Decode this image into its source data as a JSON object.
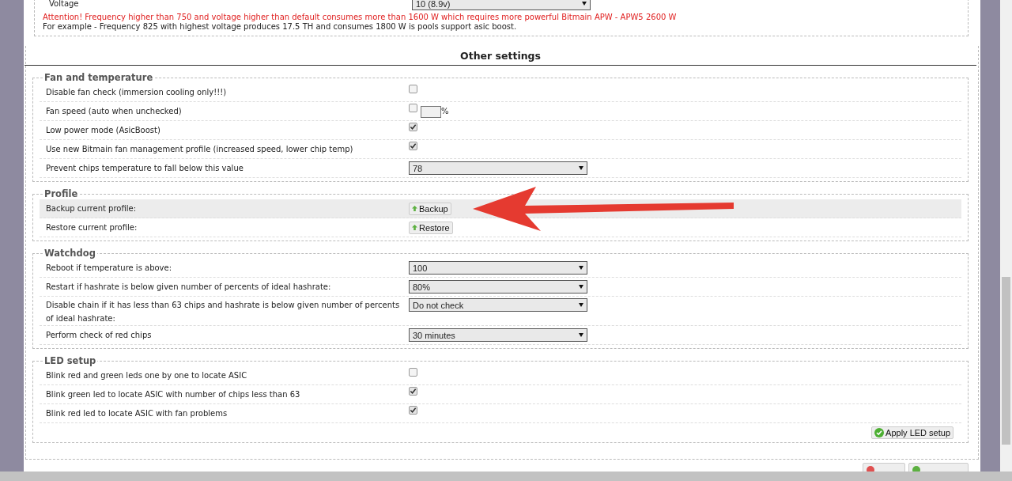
{
  "top_section": {
    "voltage_label": "Voltage",
    "voltage_value": "10 (8.9v)",
    "warning": "Attention! Frequency higher than 750 and voltage higher than default consumes more than 1600 W which requires more powerful Bitmain APW - APW5 2600 W",
    "note": "For example - Frequency 825 with highest voltage produces 17.5 TH and consumes 1800 W is pools support asic boost."
  },
  "heading": "Other settings",
  "sections": [
    {
      "title": "Fan and temperature",
      "rows": [
        {
          "kind": "checkbox",
          "label": "Disable fan check (immersion cooling only!!!)",
          "checked": false,
          "highlighted": false
        },
        {
          "kind": "percent",
          "label": "Fan speed (auto when unchecked)",
          "checked": false,
          "unit": "%",
          "highlighted": false
        },
        {
          "kind": "checkbox",
          "label": "Low power mode (AsicBoost)",
          "checked": true,
          "highlighted": false
        },
        {
          "kind": "checkbox",
          "label": "Use new Bitmain fan management profile (increased speed, lower chip temp)",
          "checked": true,
          "highlighted": false
        },
        {
          "kind": "select",
          "label": "Prevent chips temperature to fall below this value",
          "value": "78",
          "highlighted": false
        }
      ]
    },
    {
      "title": "Profile",
      "rows": [
        {
          "kind": "button",
          "label": "Backup current profile:",
          "button": "Backup",
          "highlighted": true
        },
        {
          "kind": "button",
          "label": "Restore current profile:",
          "button": "Restore",
          "highlighted": false
        }
      ]
    },
    {
      "title": "Watchdog",
      "rows": [
        {
          "kind": "select",
          "label": "Reboot if temperature is above:",
          "value": "100",
          "highlighted": false
        },
        {
          "kind": "select",
          "label": "Restart if hashrate is below given number of percents of ideal hashrate:",
          "value": "80%",
          "highlighted": false
        },
        {
          "kind": "select",
          "label": "Disable chain if it has less than 63 chips and hashrate is below given number of percents of ideal hashrate:",
          "value": "Do not check",
          "highlighted": false
        },
        {
          "kind": "select",
          "label": "Perform check of red chips",
          "value": "30 minutes",
          "highlighted": false
        }
      ]
    },
    {
      "title": "LED setup",
      "rows": [
        {
          "kind": "checkbox",
          "label": "Blink red and green leds one by one to locate ASIC",
          "checked": false,
          "highlighted": false
        },
        {
          "kind": "checkbox",
          "label": "Blink green led to locate ASIC with number of chips less than 63",
          "checked": true,
          "highlighted": false
        },
        {
          "kind": "checkbox",
          "label": "Blink red led to locate ASIC with fan problems",
          "checked": true,
          "highlighted": false
        }
      ],
      "action_button": "Apply LED setup"
    }
  ]
}
